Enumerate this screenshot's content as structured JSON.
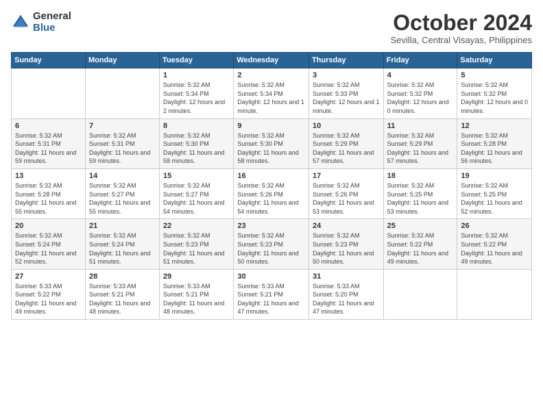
{
  "logo": {
    "general": "General",
    "blue": "Blue"
  },
  "title": "October 2024",
  "subtitle": "Sevilla, Central Visayas, Philippines",
  "headers": [
    "Sunday",
    "Monday",
    "Tuesday",
    "Wednesday",
    "Thursday",
    "Friday",
    "Saturday"
  ],
  "weeks": [
    [
      null,
      null,
      {
        "day": "1",
        "sunrise": "Sunrise: 5:32 AM",
        "sunset": "Sunset: 5:34 PM",
        "daylight": "Daylight: 12 hours and 2 minutes."
      },
      {
        "day": "2",
        "sunrise": "Sunrise: 5:32 AM",
        "sunset": "Sunset: 5:34 PM",
        "daylight": "Daylight: 12 hours and 1 minute."
      },
      {
        "day": "3",
        "sunrise": "Sunrise: 5:32 AM",
        "sunset": "Sunset: 5:33 PM",
        "daylight": "Daylight: 12 hours and 1 minute."
      },
      {
        "day": "4",
        "sunrise": "Sunrise: 5:32 AM",
        "sunset": "Sunset: 5:32 PM",
        "daylight": "Daylight: 12 hours and 0 minutes."
      },
      {
        "day": "5",
        "sunrise": "Sunrise: 5:32 AM",
        "sunset": "Sunset: 5:32 PM",
        "daylight": "Daylight: 12 hours and 0 minutes."
      }
    ],
    [
      {
        "day": "6",
        "sunrise": "Sunrise: 5:32 AM",
        "sunset": "Sunset: 5:31 PM",
        "daylight": "Daylight: 11 hours and 59 minutes."
      },
      {
        "day": "7",
        "sunrise": "Sunrise: 5:32 AM",
        "sunset": "Sunset: 5:31 PM",
        "daylight": "Daylight: 11 hours and 59 minutes."
      },
      {
        "day": "8",
        "sunrise": "Sunrise: 5:32 AM",
        "sunset": "Sunset: 5:30 PM",
        "daylight": "Daylight: 11 hours and 58 minutes."
      },
      {
        "day": "9",
        "sunrise": "Sunrise: 5:32 AM",
        "sunset": "Sunset: 5:30 PM",
        "daylight": "Daylight: 11 hours and 58 minutes."
      },
      {
        "day": "10",
        "sunrise": "Sunrise: 5:32 AM",
        "sunset": "Sunset: 5:29 PM",
        "daylight": "Daylight: 11 hours and 57 minutes."
      },
      {
        "day": "11",
        "sunrise": "Sunrise: 5:32 AM",
        "sunset": "Sunset: 5:29 PM",
        "daylight": "Daylight: 11 hours and 57 minutes."
      },
      {
        "day": "12",
        "sunrise": "Sunrise: 5:32 AM",
        "sunset": "Sunset: 5:28 PM",
        "daylight": "Daylight: 11 hours and 56 minutes."
      }
    ],
    [
      {
        "day": "13",
        "sunrise": "Sunrise: 5:32 AM",
        "sunset": "Sunset: 5:28 PM",
        "daylight": "Daylight: 11 hours and 55 minutes."
      },
      {
        "day": "14",
        "sunrise": "Sunrise: 5:32 AM",
        "sunset": "Sunset: 5:27 PM",
        "daylight": "Daylight: 11 hours and 55 minutes."
      },
      {
        "day": "15",
        "sunrise": "Sunrise: 5:32 AM",
        "sunset": "Sunset: 5:27 PM",
        "daylight": "Daylight: 11 hours and 54 minutes."
      },
      {
        "day": "16",
        "sunrise": "Sunrise: 5:32 AM",
        "sunset": "Sunset: 5:26 PM",
        "daylight": "Daylight: 11 hours and 54 minutes."
      },
      {
        "day": "17",
        "sunrise": "Sunrise: 5:32 AM",
        "sunset": "Sunset: 5:26 PM",
        "daylight": "Daylight: 11 hours and 53 minutes."
      },
      {
        "day": "18",
        "sunrise": "Sunrise: 5:32 AM",
        "sunset": "Sunset: 5:25 PM",
        "daylight": "Daylight: 11 hours and 53 minutes."
      },
      {
        "day": "19",
        "sunrise": "Sunrise: 5:32 AM",
        "sunset": "Sunset: 5:25 PM",
        "daylight": "Daylight: 11 hours and 52 minutes."
      }
    ],
    [
      {
        "day": "20",
        "sunrise": "Sunrise: 5:32 AM",
        "sunset": "Sunset: 5:24 PM",
        "daylight": "Daylight: 11 hours and 52 minutes."
      },
      {
        "day": "21",
        "sunrise": "Sunrise: 5:32 AM",
        "sunset": "Sunset: 5:24 PM",
        "daylight": "Daylight: 11 hours and 51 minutes."
      },
      {
        "day": "22",
        "sunrise": "Sunrise: 5:32 AM",
        "sunset": "Sunset: 5:23 PM",
        "daylight": "Daylight: 11 hours and 51 minutes."
      },
      {
        "day": "23",
        "sunrise": "Sunrise: 5:32 AM",
        "sunset": "Sunset: 5:23 PM",
        "daylight": "Daylight: 11 hours and 50 minutes."
      },
      {
        "day": "24",
        "sunrise": "Sunrise: 5:32 AM",
        "sunset": "Sunset: 5:23 PM",
        "daylight": "Daylight: 11 hours and 50 minutes."
      },
      {
        "day": "25",
        "sunrise": "Sunrise: 5:32 AM",
        "sunset": "Sunset: 5:22 PM",
        "daylight": "Daylight: 11 hours and 49 minutes."
      },
      {
        "day": "26",
        "sunrise": "Sunrise: 5:32 AM",
        "sunset": "Sunset: 5:22 PM",
        "daylight": "Daylight: 11 hours and 49 minutes."
      }
    ],
    [
      {
        "day": "27",
        "sunrise": "Sunrise: 5:33 AM",
        "sunset": "Sunset: 5:22 PM",
        "daylight": "Daylight: 11 hours and 49 minutes."
      },
      {
        "day": "28",
        "sunrise": "Sunrise: 5:33 AM",
        "sunset": "Sunset: 5:21 PM",
        "daylight": "Daylight: 11 hours and 48 minutes."
      },
      {
        "day": "29",
        "sunrise": "Sunrise: 5:33 AM",
        "sunset": "Sunset: 5:21 PM",
        "daylight": "Daylight: 11 hours and 48 minutes."
      },
      {
        "day": "30",
        "sunrise": "Sunrise: 5:33 AM",
        "sunset": "Sunset: 5:21 PM",
        "daylight": "Daylight: 11 hours and 47 minutes."
      },
      {
        "day": "31",
        "sunrise": "Sunrise: 5:33 AM",
        "sunset": "Sunset: 5:20 PM",
        "daylight": "Daylight: 11 hours and 47 minutes."
      },
      null,
      null
    ]
  ]
}
